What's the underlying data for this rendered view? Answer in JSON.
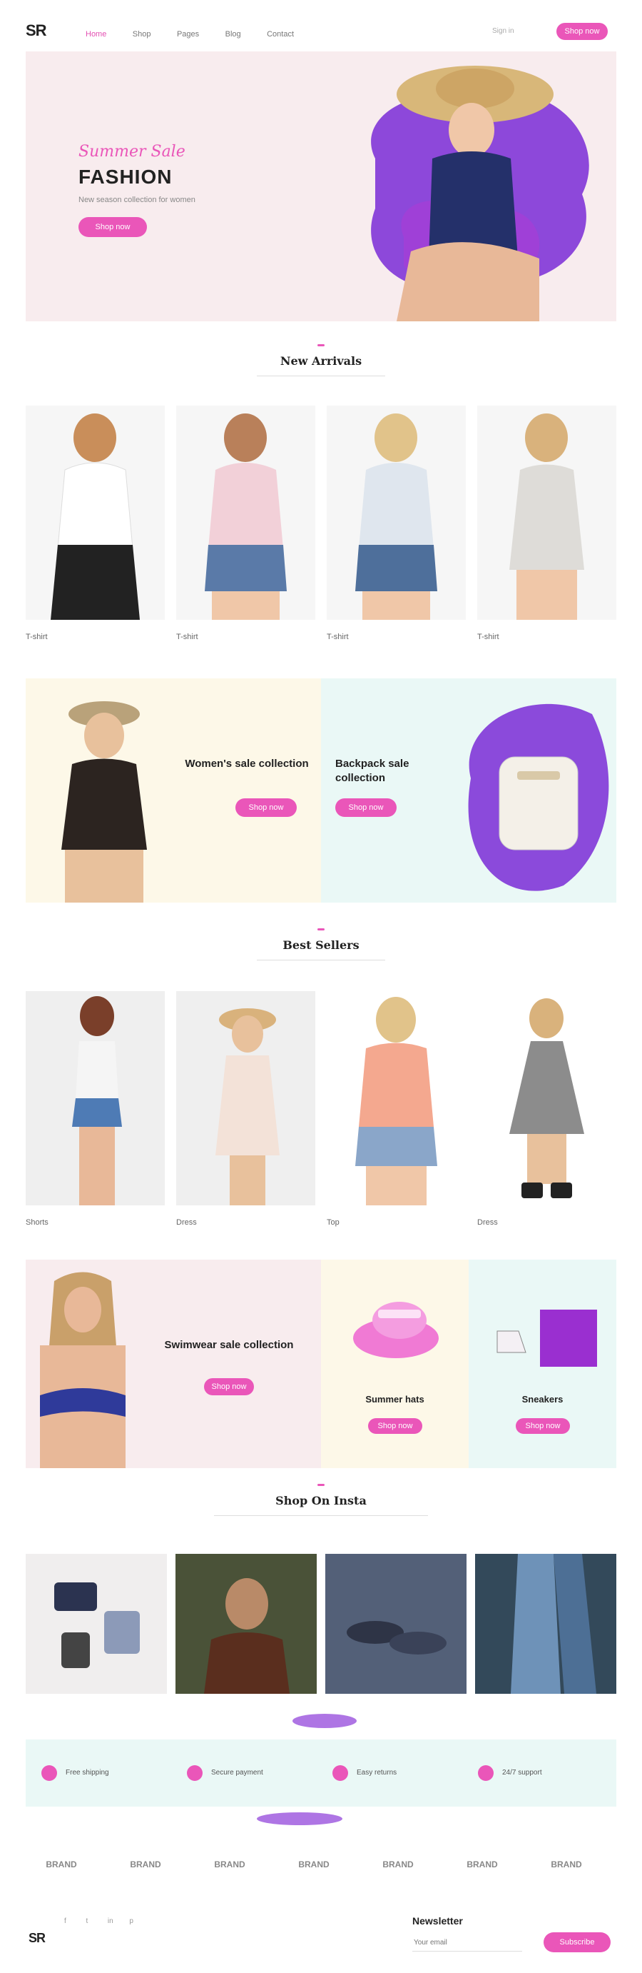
{
  "header": {
    "logo": "SR",
    "nav": [
      "Home",
      "Shop",
      "Pages",
      "Blog",
      "Contact"
    ],
    "account": "Sign in",
    "cta": "Shop now"
  },
  "hero": {
    "kicker": "Summer Sale",
    "title": "FASHION",
    "subtitle": "New season collection for women",
    "button": "Shop now"
  },
  "sections": {
    "new_arrivals": "New Arrivals",
    "best_sellers": "Best Sellers",
    "instagram": "Shop On Insta"
  },
  "new_arrivals": [
    {
      "name": "T-shirt",
      "color": "#ffffff",
      "pants": "#222222"
    },
    {
      "name": "T-shirt",
      "color": "#f2d0d8",
      "pants": "#5a7aa8"
    },
    {
      "name": "T-shirt",
      "color": "#dfe6ee",
      "pants": "#4e6f9b"
    },
    {
      "name": "T-shirt",
      "color": "#dedcd8",
      "pants": "#d8d4cf"
    }
  ],
  "promos": [
    {
      "title": "Women's sale collection",
      "button": "Shop now"
    },
    {
      "title": "Backpack sale collection",
      "button": "Shop now"
    }
  ],
  "best_sellers": [
    {
      "name": "Shorts",
      "color": "#f5f5f5",
      "pants": "#4e7bb5"
    },
    {
      "name": "Dress",
      "color": "#f3e2d8",
      "pants": "#f3e2d8"
    },
    {
      "name": "Top",
      "color": "#f4a88f",
      "pants": "#8aa6c9"
    },
    {
      "name": "Dress",
      "color": "#8c8c8c",
      "pants": "#8c8c8c"
    }
  ],
  "promo_row2": [
    {
      "title": "Swimwear sale collection",
      "button": "Shop now"
    },
    {
      "title": "Summer hats",
      "button": "Shop now"
    },
    {
      "title": "Sneakers",
      "button": "Shop now"
    }
  ],
  "features": [
    "Free shipping",
    "Secure payment",
    "Easy returns",
    "24/7 support"
  ],
  "brands": [
    "BRAND",
    "BRAND",
    "BRAND",
    "BRAND",
    "BRAND",
    "BRAND",
    "BRAND"
  ],
  "footer": {
    "logo": "SR",
    "social": [
      "f",
      "t",
      "in",
      "p"
    ],
    "newsletter_title": "Newsletter",
    "newsletter_placeholder": "Your email",
    "subscribe": "Subscribe"
  },
  "colors": {
    "accent": "#ea56b9",
    "hero_bg": "#f8ecee",
    "cream": "#fdf8e8",
    "mint": "#eaf8f6",
    "purple": "#7a2bd6"
  }
}
